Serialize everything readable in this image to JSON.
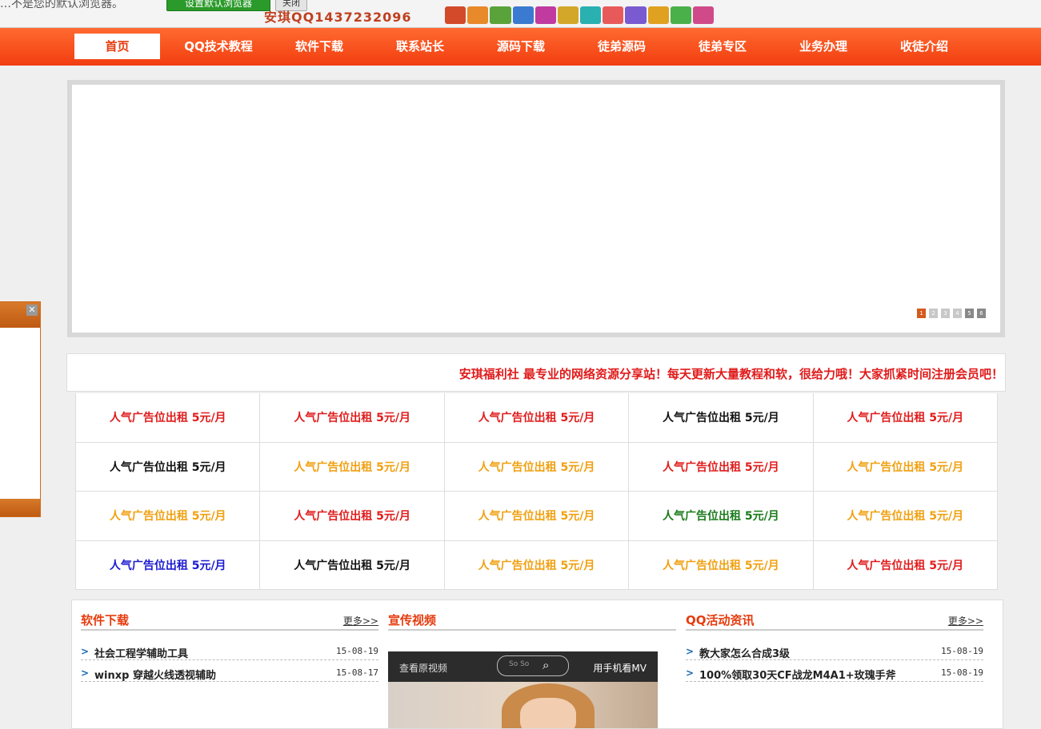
{
  "topbar": {
    "note": "…不是您的默认浏览器。",
    "primary_button": "设置默认浏览器",
    "close_button": "关闭",
    "contact": "安琪QQ1437232096",
    "icon_colors": [
      "#d34a2a",
      "#e8892a",
      "#5aa33a",
      "#3a7ad0",
      "#c03aa0",
      "#d3a82a",
      "#2ab0b0",
      "#e85a5a",
      "#7a5ad0",
      "#e0a020",
      "#4ab04a",
      "#d04a8a"
    ]
  },
  "nav": {
    "items": [
      "首页",
      "QQ技术教程",
      "软件下载",
      "联系站长",
      "源码下载",
      "徒弟源码",
      "徒弟专区",
      "业务办理",
      "收徒介绍"
    ]
  },
  "banner": {
    "dots": [
      "1",
      "2",
      "3",
      "4",
      "5",
      "6"
    ]
  },
  "slogan": "安琪福利社 最专业的网络资源分享站！每天更新大量教程和软，很给力哦！大家抓紧时间注册会员吧！",
  "ads": {
    "cells": [
      {
        "text": "人气广告位出租 5元/月",
        "color": "#e01b1b"
      },
      {
        "text": "人气广告位出租 5元/月",
        "color": "#e01b1b"
      },
      {
        "text": "人气广告位出租 5元/月",
        "color": "#e01b1b"
      },
      {
        "text": "人气广告位出租 5元/月",
        "color": "#111111"
      },
      {
        "text": "人气广告位出租 5元/月",
        "color": "#e01b1b"
      },
      {
        "text": "人气广告位出租 5元/月",
        "color": "#111111"
      },
      {
        "text": "人气广告位出租 5元/月",
        "color": "#f0a010"
      },
      {
        "text": "人气广告位出租 5元/月",
        "color": "#f0a010"
      },
      {
        "text": "人气广告位出租 5元/月",
        "color": "#e01b1b"
      },
      {
        "text": "人气广告位出租 5元/月",
        "color": "#f0a010"
      },
      {
        "text": "人气广告位出租 5元/月",
        "color": "#f0a010"
      },
      {
        "text": "人气广告位出租 5元/月",
        "color": "#e01b1b"
      },
      {
        "text": "人气广告位出租 5元/月",
        "color": "#f0a010"
      },
      {
        "text": "人气广告位出租 5元/月",
        "color": "#1a7a1a"
      },
      {
        "text": "人气广告位出租 5元/月",
        "color": "#f0a010"
      },
      {
        "text": "人气广告位出租 5元/月",
        "color": "#1a1ad0"
      },
      {
        "text": "人气广告位出租 5元/月",
        "color": "#111111"
      },
      {
        "text": "人气广告位出租 5元/月",
        "color": "#f0a010"
      },
      {
        "text": "人气广告位出租 5元/月",
        "color": "#f0a010"
      },
      {
        "text": "人气广告位出租 5元/月",
        "color": "#e01b1b"
      }
    ]
  },
  "software": {
    "title": "软件下载",
    "more": "更多>>",
    "items": [
      {
        "text": "社会工程学辅助工具",
        "date": "15-08-19"
      },
      {
        "text": "winxp 穿越火线透视辅助",
        "date": "15-08-17"
      }
    ]
  },
  "video": {
    "title": "宣传视频",
    "left_label": "查看原视频",
    "search_text": "So So",
    "right_label": "用手机看MV"
  },
  "news": {
    "title": "QQ活动资讯",
    "more": "更多>>",
    "items": [
      {
        "text": "教大家怎么合成3级",
        "date": "15-08-19"
      },
      {
        "text": "100%领取30天CF战龙M4A1+玫瑰手斧",
        "date": "15-08-19"
      }
    ]
  }
}
